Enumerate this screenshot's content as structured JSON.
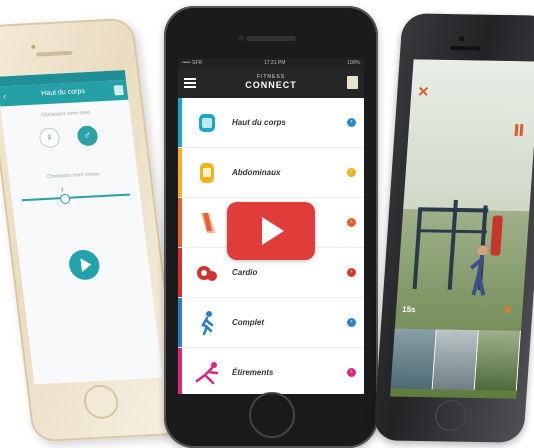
{
  "left_phone": {
    "header_title": "Haut du corps",
    "back_icon": "chevron-left-icon",
    "subtitle": "Choisissez votre sexe",
    "gender_female_icon": "female-icon",
    "gender_male_icon": "male-icon",
    "subtitle2": "Choisissez votre niveau",
    "slider_value": "2",
    "play_icon": "play-icon"
  },
  "center_phone": {
    "status_left": "••••• SFR",
    "status_time": "17:31 PM",
    "status_right": "100%",
    "brand_top": "FITNESS",
    "brand": "CONNECT",
    "menu_icon": "hamburger-icon",
    "notes_icon": "notepad-icon",
    "items": [
      {
        "label": "Haut du corps",
        "bar_color": "#1aa7c7",
        "arrow_color": "#2e88c9",
        "icon": "upper-body-icon"
      },
      {
        "label": "Abdominaux",
        "bar_color": "#f2b21b",
        "arrow_color": "#f0b020",
        "icon": "abs-icon"
      },
      {
        "label": "",
        "bar_color": "#e8622d",
        "arrow_color": "#e5602b",
        "icon": "legs-icon"
      },
      {
        "label": "Cardio",
        "bar_color": "#d2312f",
        "arrow_color": "#d23a33",
        "icon": "cardio-icon"
      },
      {
        "label": "Complet",
        "bar_color": "#2a7fc4",
        "arrow_color": "#2b82c6",
        "icon": "runner-icon"
      },
      {
        "label": "Étirements",
        "bar_color": "#d8287a",
        "arrow_color": "#d8297a",
        "icon": "stretch-icon"
      }
    ]
  },
  "video_overlay": {
    "play_button_color": "#e03c3a",
    "icon": "youtube-play-icon"
  },
  "right_phone": {
    "close_icon": "close-icon",
    "pause_icon": "pause-icon",
    "timer": "15s",
    "accent_color": "#e25a2c"
  }
}
